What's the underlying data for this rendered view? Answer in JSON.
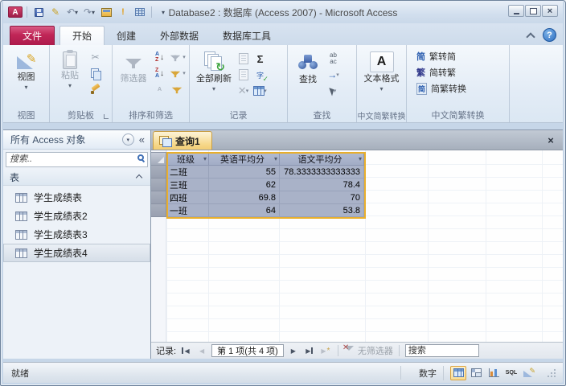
{
  "window": {
    "title": "Database2 : 数据库 (Access 2007) - Microsoft Access"
  },
  "glyphs": {
    "caret_down": "▾",
    "chevrons_left": "«",
    "close_x": "×",
    "help": "?",
    "sigma": "Σ",
    "scissors": "✂",
    "undo": "↶",
    "redo": "↷",
    "refresh": "↻",
    "arrow_right": "→",
    "arrow_down": "↓",
    "excl": "!",
    "pencil": "✎",
    "letter_a": "A",
    "letter_z": "Z",
    "ab": "ab",
    "ac": "ac",
    "check": "✓",
    "spell_char": "字",
    "conv_simp": "简",
    "conv_trad": "繁",
    "star": "*",
    "prev": "◀",
    "next": "▶",
    "delete_x": "✕"
  },
  "ribbon": {
    "tabs": [
      {
        "label": "文件"
      },
      {
        "label": "开始"
      },
      {
        "label": "创建"
      },
      {
        "label": "外部数据"
      },
      {
        "label": "数据库工具"
      }
    ],
    "active_tab": "开始",
    "group_labels": [
      "视图",
      "剪贴板",
      "排序和筛选",
      "记录",
      "查找",
      "中文简繁转换"
    ],
    "view_button": "视图",
    "paste_button": "粘贴",
    "filter_button": "筛选器",
    "refresh_button": "全部刷新",
    "find_button": "查找",
    "text_format_button": "文本格式",
    "conversion_items": [
      "繁转简",
      "简转繁",
      "简繁转换"
    ]
  },
  "nav": {
    "title": "所有 Access 对象",
    "search_placeholder": "搜索..",
    "section_label": "表",
    "items": [
      "学生成绩表",
      "学生成绩表2",
      "学生成绩表3",
      "学生成绩表4"
    ],
    "selected_item": "学生成绩表4"
  },
  "doc": {
    "tab_label": "查询1",
    "columns": [
      "班级",
      "英语平均分",
      "语文平均分"
    ],
    "rows": [
      [
        "二班",
        "55",
        "78.3333333333333"
      ],
      [
        "三班",
        "62",
        "78.4"
      ],
      [
        "四班",
        "69.8",
        "70"
      ],
      [
        "一班",
        "64",
        "53.8"
      ]
    ]
  },
  "rec": {
    "label": "记录:",
    "position": "第 1 项(共 4 项)",
    "no_filter": "无筛选器",
    "search_placeholder": "搜索"
  },
  "status": {
    "ready": "就绪",
    "num_lock": "数字",
    "sql_label": "SQL"
  },
  "colors": {
    "accent_gold": "#e9af2d",
    "selection_fill": "#a9b2c8",
    "file_tab_red": "#c02657",
    "help_blue": "#2f6fc1",
    "active_doc_tab": "#f2cd74"
  }
}
